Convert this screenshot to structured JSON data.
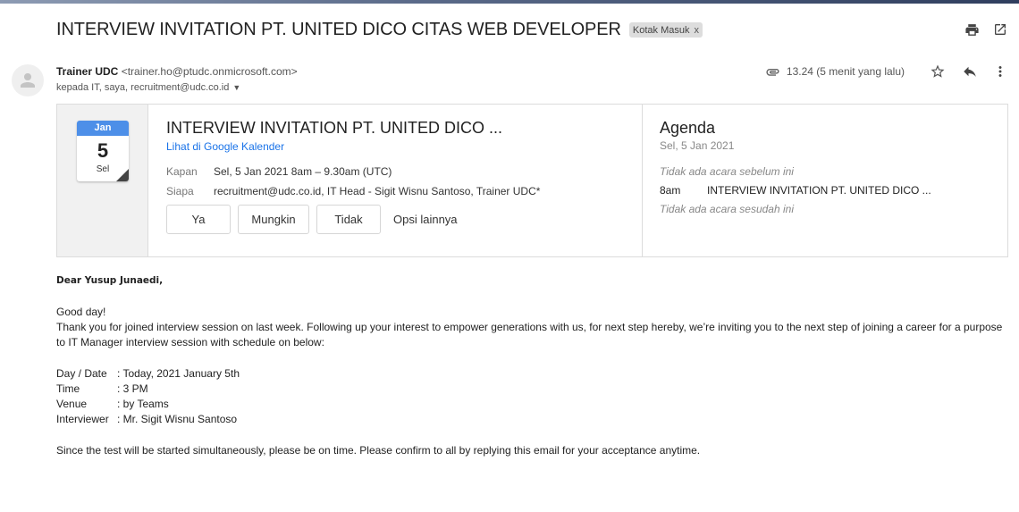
{
  "email": {
    "subject": "INTERVIEW INVITATION PT. UNITED DICO CITAS WEB DEVELOPER",
    "label": "Kotak Masuk",
    "label_remove": "x",
    "sender_name": "Trainer UDC",
    "sender_email": "<trainer.ho@ptudc.onmicrosoft.com>",
    "recipients": "kepada IT, saya, recruitment@udc.co.id",
    "time": "13.24 (5 menit yang lalu)"
  },
  "icons": {
    "print": "print-icon",
    "open_new": "open-in-new-window-icon",
    "attachment": "paperclip-icon",
    "star": "star-icon",
    "reply": "reply-icon",
    "more": "more-vertical-icon",
    "avatar": "person-icon",
    "caret": "caret-down-icon"
  },
  "invite": {
    "calendar": {
      "month": "Jan",
      "day": "5",
      "weekday": "Sel"
    },
    "title": "INTERVIEW INVITATION PT. UNITED DICO ...",
    "gcal_link": "Lihat di Google Kalender",
    "when_label": "Kapan",
    "when_value": "Sel, 5 Jan 2021 8am – 9.30am (UTC)",
    "who_label": "Siapa",
    "who_value": "recruitment@udc.co.id, IT Head - Sigit Wisnu Santoso, Trainer UDC*",
    "rsvp": {
      "yes": "Ya",
      "maybe": "Mungkin",
      "no": "Tidak",
      "more": "Opsi lainnya"
    }
  },
  "agenda": {
    "title": "Agenda",
    "date": "Sel, 5 Jan 2021",
    "before": "Tidak ada acara sebelum ini",
    "item_time": "8am",
    "item_title": "INTERVIEW INVITATION PT. UNITED DICO ...",
    "after": "Tidak ada acara sesudah ini"
  },
  "body": {
    "greeting": "Dear Yusup Junaedi,",
    "line1": "Good day!",
    "line2": "Thank you for joined interview session on last week. Following up your interest to empower generations with us, for next step hereby, we’re inviting you to the next step of joining a career for a purpose to IT Manager interview session with schedule on below:",
    "details": [
      {
        "key": "Day / Date",
        "value": ": Today, 2021 January 5th"
      },
      {
        "key": "Time",
        "value": ": 3 PM"
      },
      {
        "key": "Venue",
        "value": ": by Teams"
      },
      {
        "key": "Interviewer",
        "value": ": Mr. Sigit Wisnu Santoso"
      }
    ],
    "closing": "Since the test will be started simultaneously, please be on time.  Please confirm to all by replying this email for your acceptance anytime."
  },
  "colors": {
    "link": "#1a73e8",
    "calendar_header": "#4d8fe8",
    "label_bg": "#dddddd"
  }
}
